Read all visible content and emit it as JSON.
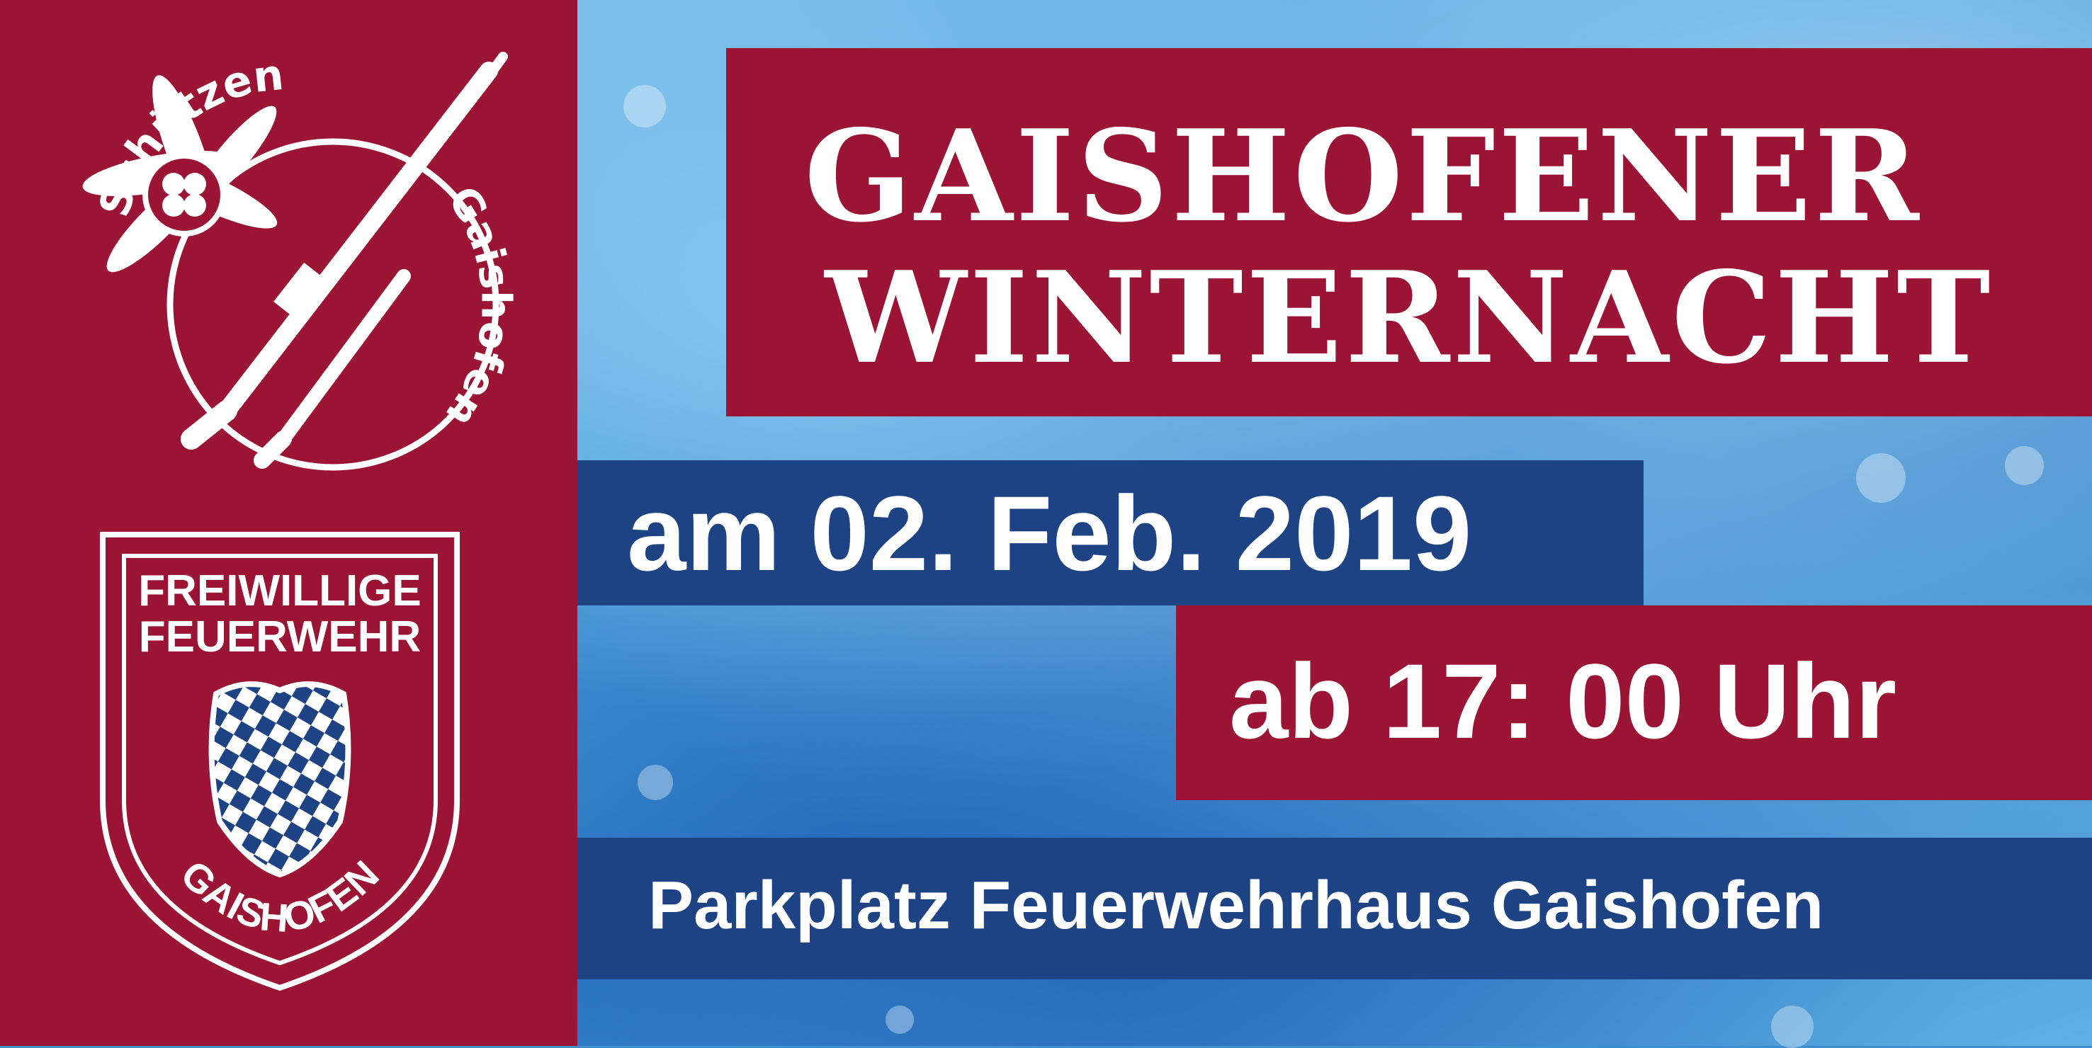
{
  "colors": {
    "primary_red": "#9b1433",
    "primary_blue": "#1d4384",
    "text": "#ffffff"
  },
  "logos": {
    "schuetzen": {
      "word_top": "Schützen",
      "word_side": "Gaishofen",
      "icon": "edelweiss-and-rifles-icon"
    },
    "feuerwehr": {
      "line1": "FREIWILLIGE",
      "line2": "FEUERWEHR",
      "place": "GAISHOFEN",
      "icon": "bavarian-shield-icon"
    }
  },
  "event": {
    "title_line1": "GAISHOFENER",
    "title_line2": "WINTERNACHT",
    "date": "am 02. Feb. 2019",
    "time": "ab 17: 00 Uhr",
    "location": "Parkplatz Feuerwehrhaus Gaishofen"
  }
}
